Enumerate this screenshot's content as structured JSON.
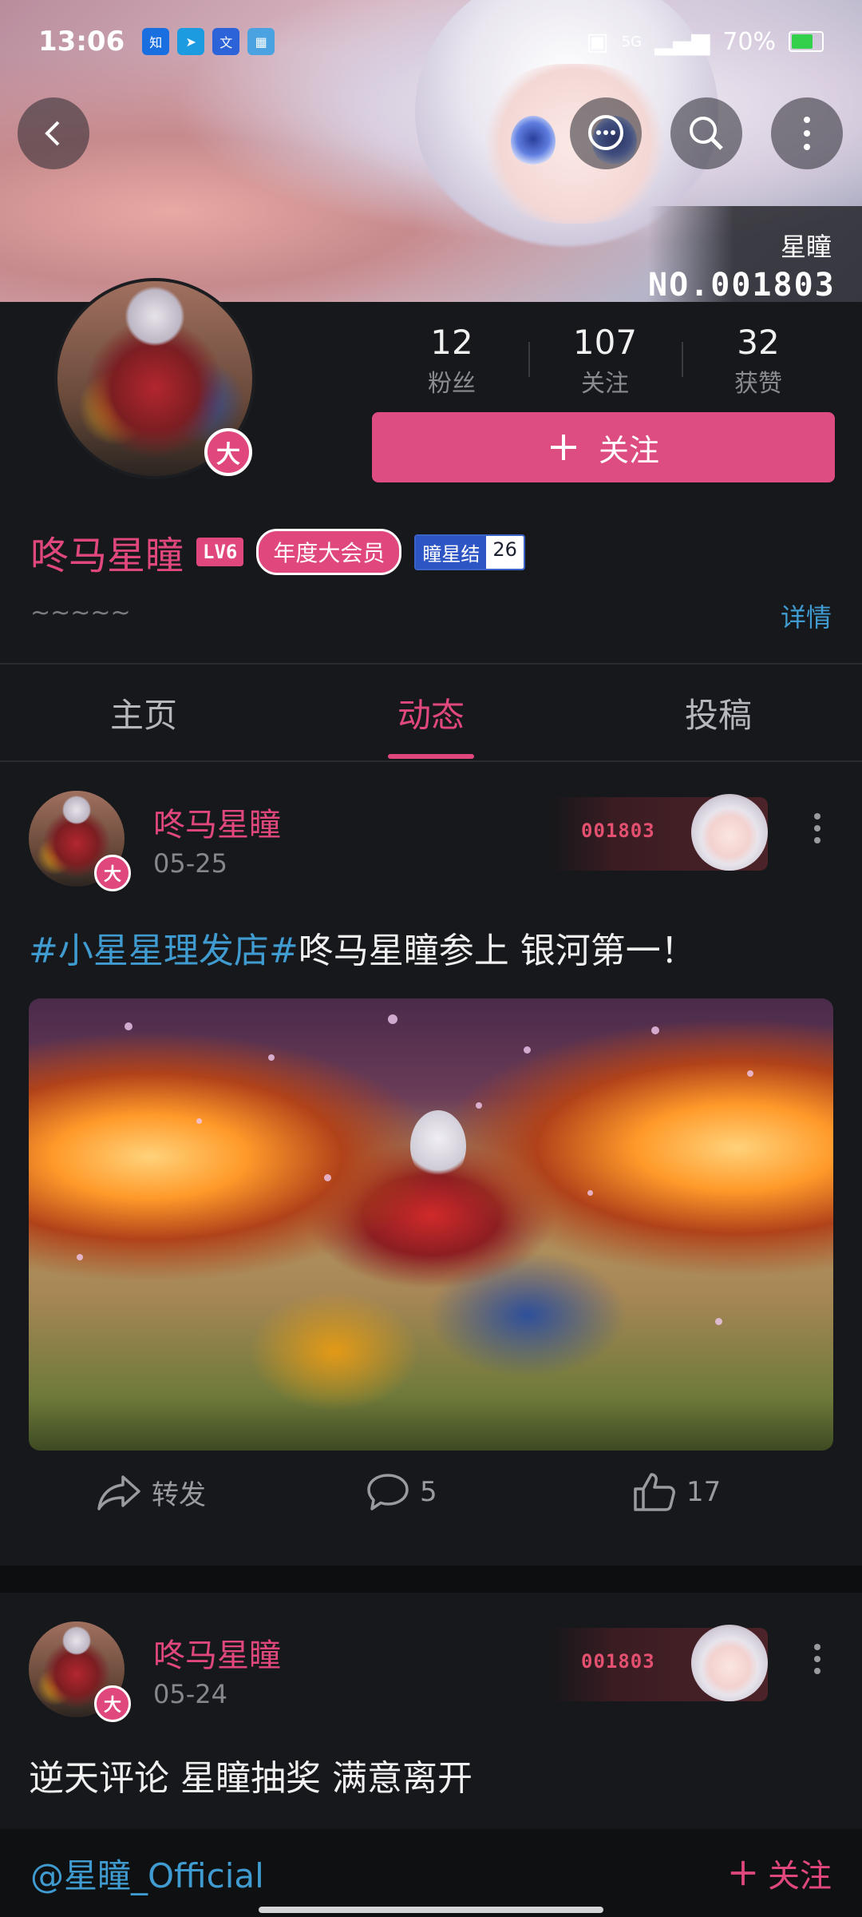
{
  "status_bar": {
    "time": "13:06",
    "battery": "70%",
    "battery_level": 0.7,
    "network": "5G"
  },
  "banner": {
    "name_label": "星瞳",
    "id_number": "NO.001803"
  },
  "profile": {
    "stats": [
      {
        "value": "12",
        "label": "粉丝"
      },
      {
        "value": "107",
        "label": "关注"
      },
      {
        "value": "32",
        "label": "获赞"
      }
    ],
    "follow_button": "关注",
    "username": "咚马星瞳",
    "level": "LV6",
    "vip_label": "年度大会员",
    "fan_badge": {
      "name": "瞳星结",
      "level": "26"
    },
    "signature": "~~~~~",
    "detail_link": "详情",
    "avatar_badge": "大"
  },
  "tabs": [
    {
      "label": "主页",
      "active": false
    },
    {
      "label": "动态",
      "active": true
    },
    {
      "label": "投稿",
      "active": false
    }
  ],
  "posts": [
    {
      "author": "咚马星瞳",
      "date": "05-25",
      "card_number": "001803",
      "topic": "#小星星理发店#",
      "text": "咚马星瞳参上 银河第一！",
      "actions": {
        "forward": "转发",
        "comments": "5",
        "likes": "17"
      }
    },
    {
      "author": "咚马星瞳",
      "date": "05-24",
      "card_number": "001803",
      "text": "逆天评论 星瞳抽奖 满意离开"
    }
  ],
  "bottom_bar": {
    "handle": "@星瞳_Official",
    "follow_label": "关注"
  },
  "colors": {
    "accent": "#e0487d",
    "link": "#3f9bd0",
    "background": "#17181b"
  }
}
